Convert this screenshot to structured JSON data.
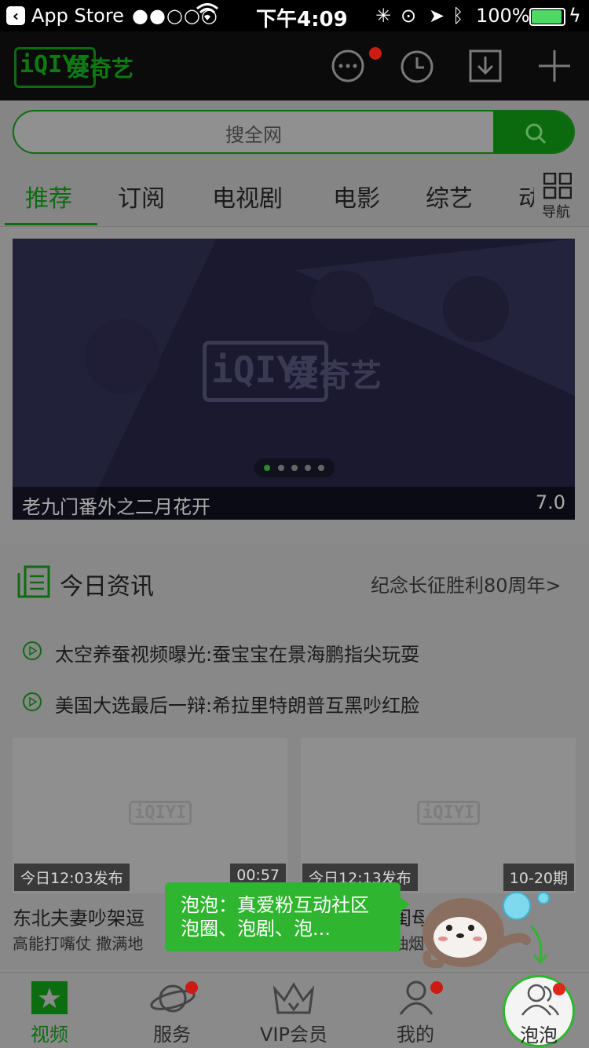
{
  "status_bar": {
    "back_label": "App Store",
    "signal": "●●○○○",
    "time": "下午4:09",
    "battery": "100%"
  },
  "app": {
    "logo_text": "iQIYI",
    "logo_cn": "爱奇艺"
  },
  "search": {
    "placeholder": "搜全网"
  },
  "tabs": [
    {
      "label": "推荐",
      "active": true
    },
    {
      "label": "订阅"
    },
    {
      "label": "电视剧"
    },
    {
      "label": "电影"
    },
    {
      "label": "综艺"
    },
    {
      "label": "动"
    }
  ],
  "nav_grid_label": "导航",
  "banner": {
    "watermark": "爱奇艺",
    "watermark_logo": "iQIYI",
    "title": "老九门番外之二月花开",
    "score": "7.0",
    "dots_total": 5,
    "dots_active": 0
  },
  "news": {
    "header": "今日资讯",
    "more": "纪念长征胜利80周年>",
    "items": [
      "太空养蚕视频曝光:蚕宝宝在景海鹏指尖玩耍",
      "美国大选最后一辩:希拉里特朗普互黑吵红脸"
    ],
    "cards": [
      {
        "badge_left": "今日12:03发布",
        "badge_right": "00:57",
        "title": "东北夫妻吵架逗",
        "subtitle": "高能打嘴仗 撒满地"
      },
      {
        "badge_left": "今日12:13发布",
        "badge_right": "10-20期",
        "title": "闺母",
        "subtitle": "抽烟"
      }
    ]
  },
  "tooltip": {
    "text": "泡泡：真爱粉互动社区泡圈、泡剧、泡..."
  },
  "bottom_nav": [
    {
      "label": "视频",
      "active": true
    },
    {
      "label": "服务"
    },
    {
      "label": "VIP会员"
    },
    {
      "label": "我的"
    },
    {
      "label": "泡泡"
    }
  ],
  "colors": {
    "accent": "#0c6c10",
    "tooltip": "#2fb52f",
    "notification": "#cc1b12"
  }
}
